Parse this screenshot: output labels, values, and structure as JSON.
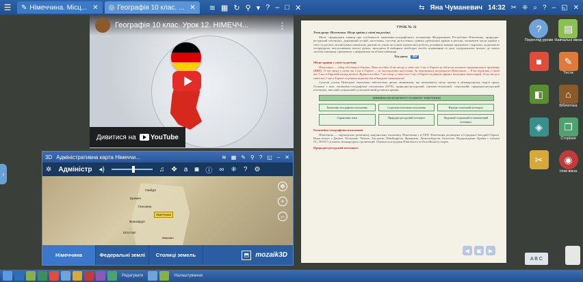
{
  "topbar": {
    "tabs": [
      {
        "label": "Німеччина. Місц...",
        "active": false
      },
      {
        "label": "Географія 10 клас. ...",
        "active": true
      }
    ],
    "user": "Яна Чуманевич",
    "time": "14:32"
  },
  "youtube": {
    "title": "Географія 10 клас. Урок 12. НІМЕЧЧ...",
    "watch_label": "Дивитися на",
    "brand": "YouTube",
    "colors": {
      "play": "#e52d27",
      "flag": [
        "#000000",
        "#dd0000",
        "#ffce00"
      ]
    }
  },
  "doc": {
    "lesson": "УРОК № 31",
    "topic_label": "Тема уроку:",
    "topic": "Німеччина. Місце країни у світі та регіоні.",
    "goal": "Мета: сформувати знання про особливості економіко-географічного положення Федеративної Республіки Німеччина, природно-ресурсний потенціал, державний устрій, населення, систему розселення і рівень урбанізації країни в регіоні, визначити місце країни у світі та регіоні; активізувати навчальну діяльність учнів на основі практичної роботи, розвивати вміння працювати з картами, додатковою літературою, висловлювати власні думки, знаходити й вибирати необхідні засоби порівняння та дані, підтримувати інтерес до нових засобів навчання, працювати з цифровими засобами навчання.",
    "flow": "Хід уроку",
    "section1": "Місце країни у світі та регіоні",
    "para1": "Німеччина — лідер об'єднаної Європи. Вона посідає 4-те місце у світі та 1-ше в Європі за обсягом валового внутрішнього продукту (ВВП), 11-те місце у світі та 1-ше в Європі — за чисельністю населення. За показником могутності Німеччина — 8-ма держава у світі та 1-ша в Європейському регіоні. Країна посідає 7-ме місце у світі та 1-ше в Європі за рівнем прямих іноземних інвестицій; 4-те місце в світі та 1-ше в Європі за рівнем науково-дослідницької активності.",
    "para2": "Сучасні успіхи Німецької економіки забезпечено двома чинниками, що визначають місце країни в міжнародному поділі праці. Основні з них: економіко-географічне положення (ЕГП), природно-ресурсний, науково-технічний, соціальний, природно-ресурсний потенціал, високий соціальний та економічний розвиток країни.",
    "schema_top": "ЧИННИКИ ЕКОНОМІЧНОГО РОЗВИТКУ НІМЕЧЧИНИ",
    "schema_row1": [
      "Економіко-географічне положення",
      "Соціально-політичне положення",
      "Науково-технічний потенціал"
    ],
    "schema_row2": [
      "Сприятливі землі",
      "Природно-ресурсний потенціал",
      "Людський соціальний та економічний потенціал"
    ],
    "section2": "Економіко-географічне положення",
    "para3": "Німеччина — партнерське розвинену національну економіку Німеччина є в ЄЕП. Німеччина розміщена в Середньо-Західній Європі. Вона межує з Данією, Польщею, Чехією, Австрією, Швейцарією, Францією, Люксембургом, Бельгією, Нідерландами. Країна є членом ЄС, НАТО та інших міжнародних організацій. Омивається водами Північного та Балтійського морів.",
    "section3": "Природно-ресурсний потенціал"
  },
  "sidebar": {
    "items": [
      {
        "label": "Перегляд уроків",
        "color": "#6fa3d9",
        "icon": "question-icon"
      },
      {
        "label": "Навчальні вікна",
        "color": "#8cc152",
        "icon": "window-icon"
      },
      {
        "label": "",
        "color": "#e04d3a",
        "icon": "red-square-icon"
      },
      {
        "label": "Тести",
        "color": "#e07a3a",
        "icon": "test-icon"
      },
      {
        "label": "",
        "color": "#5a8f2f",
        "icon": "book-icon"
      },
      {
        "label": "Бібліотека",
        "color": "#8b5a2b",
        "icon": "library-icon"
      },
      {
        "label": "",
        "color": "#3b8f8a",
        "icon": "mozaik-icon"
      },
      {
        "label": "Сторінки",
        "color": "#4fa26f",
        "icon": "pages-icon"
      },
      {
        "label": "",
        "color": "#d7a83a",
        "icon": "tools-icon"
      },
      {
        "label": "Нові вікна",
        "color": "#c23b3b",
        "icon": "new-window-icon"
      }
    ]
  },
  "mozaik": {
    "window_title": "Адміністративна карта Німеччи...",
    "toolbar_name": "Адміністр",
    "cities": [
      {
        "name": "Гамбург"
      },
      {
        "name": "Бремен"
      },
      {
        "name": "Ганновер"
      },
      {
        "name": "Німеччина",
        "highlight": true
      },
      {
        "name": "Франкфурт"
      },
      {
        "name": "Штутгарт"
      },
      {
        "name": "Мюнхен"
      }
    ],
    "tabs": [
      {
        "label": "Німеччина",
        "active": true
      },
      {
        "label": "Федеральні землі",
        "active": false
      },
      {
        "label": "Столиці земель",
        "active": false
      }
    ],
    "brand": "mozaik3D"
  },
  "taskbar": {
    "labels": [
      "Редагувати",
      "Налаштування"
    ]
  },
  "abc_label": "A B C"
}
